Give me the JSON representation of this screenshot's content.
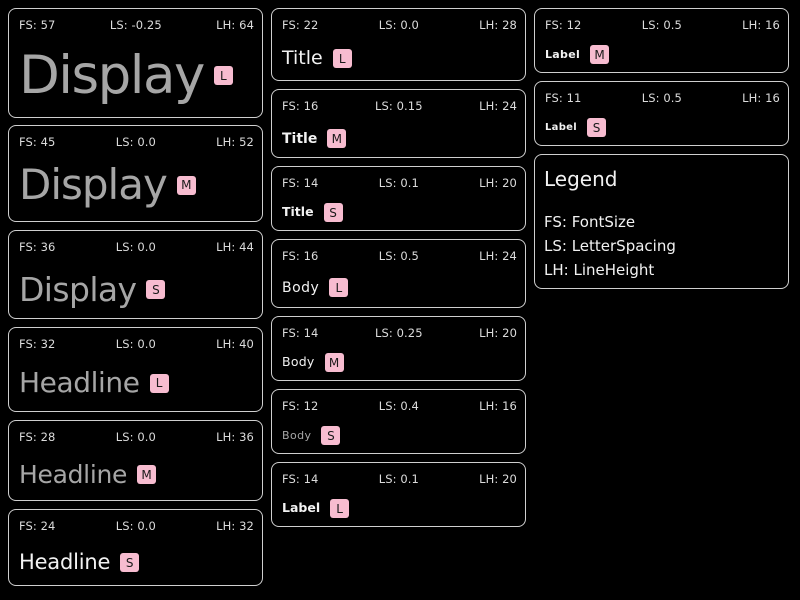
{
  "badges": {
    "l": "L",
    "m": "M",
    "s": "S"
  },
  "colors": {
    "background": "#000000",
    "border": "#cfcfcf",
    "badge": "#f7bcd0",
    "grey_text": "#a6a6a6",
    "white_text": "#f2f2f2"
  },
  "display_large": {
    "fs": "FS: 57",
    "ls": "LS: -0.25",
    "lh": "LH: 64",
    "text": "Display"
  },
  "display_medium": {
    "fs": "FS: 45",
    "ls": "LS: 0.0",
    "lh": "LH: 52",
    "text": "Display"
  },
  "display_small": {
    "fs": "FS: 36",
    "ls": "LS: 0.0",
    "lh": "LH: 44",
    "text": "Display"
  },
  "headline_large": {
    "fs": "FS: 32",
    "ls": "LS: 0.0",
    "lh": "LH: 40",
    "text": "Headline"
  },
  "headline_medium": {
    "fs": "FS: 28",
    "ls": "LS: 0.0",
    "lh": "LH: 36",
    "text": "Headline"
  },
  "headline_small": {
    "fs": "FS: 24",
    "ls": "LS: 0.0",
    "lh": "LH: 32",
    "text": "Headline"
  },
  "title_large": {
    "fs": "FS: 22",
    "ls": "LS: 0.0",
    "lh": "LH: 28",
    "text": "Title"
  },
  "title_medium": {
    "fs": "FS: 16",
    "ls": "LS: 0.15",
    "lh": "LH: 24",
    "text": "Title"
  },
  "title_small": {
    "fs": "FS: 14",
    "ls": "LS: 0.1",
    "lh": "LH: 20",
    "text": "Title"
  },
  "body_large": {
    "fs": "FS: 16",
    "ls": "LS: 0.5",
    "lh": "LH: 24",
    "text": "Body"
  },
  "body_medium": {
    "fs": "FS: 14",
    "ls": "LS: 0.25",
    "lh": "LH: 20",
    "text": "Body"
  },
  "body_small": {
    "fs": "FS: 12",
    "ls": "LS: 0.4",
    "lh": "LH: 16",
    "text": "Body"
  },
  "label_large": {
    "fs": "FS: 14",
    "ls": "LS: 0.1",
    "lh": "LH: 20",
    "text": "Label"
  },
  "label_medium": {
    "fs": "FS: 12",
    "ls": "LS: 0.5",
    "lh": "LH: 16",
    "text": "Label"
  },
  "label_small": {
    "fs": "FS: 11",
    "ls": "LS: 0.5",
    "lh": "LH: 16",
    "text": "Label"
  },
  "legend": {
    "title": "Legend",
    "fs": "FS: FontSize",
    "ls": "LS: LetterSpacing",
    "lh": "LH: LineHeight"
  }
}
